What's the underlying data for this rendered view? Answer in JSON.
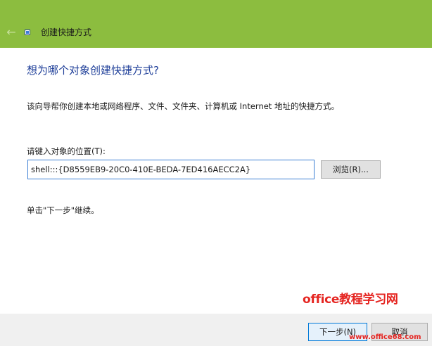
{
  "window": {
    "title": "创建快捷方式",
    "back_icon": "←"
  },
  "content": {
    "heading": "想为哪个对象创建快捷方式?",
    "description": "该向导帮你创建本地或网络程序、文件、文件夹、计算机或 Internet 地址的快捷方式。",
    "location_label": "请键入对象的位置(T):",
    "location_value": "shell:::{D8559EB9-20C0-410E-BEDA-7ED416AECC2A}",
    "browse_label": "浏览(R)...",
    "hint": "单击\"下一步\"继续。"
  },
  "footer": {
    "next_label": "下一步(N)",
    "cancel_label": "取消"
  },
  "watermark": {
    "logo_text": "office教程学习网",
    "url_text": "www.office68.com"
  },
  "colors": {
    "titlebar": "#8cbd3f",
    "heading": "#1f3f99",
    "input_border": "#3c7fd4",
    "watermark": "#e52521"
  }
}
